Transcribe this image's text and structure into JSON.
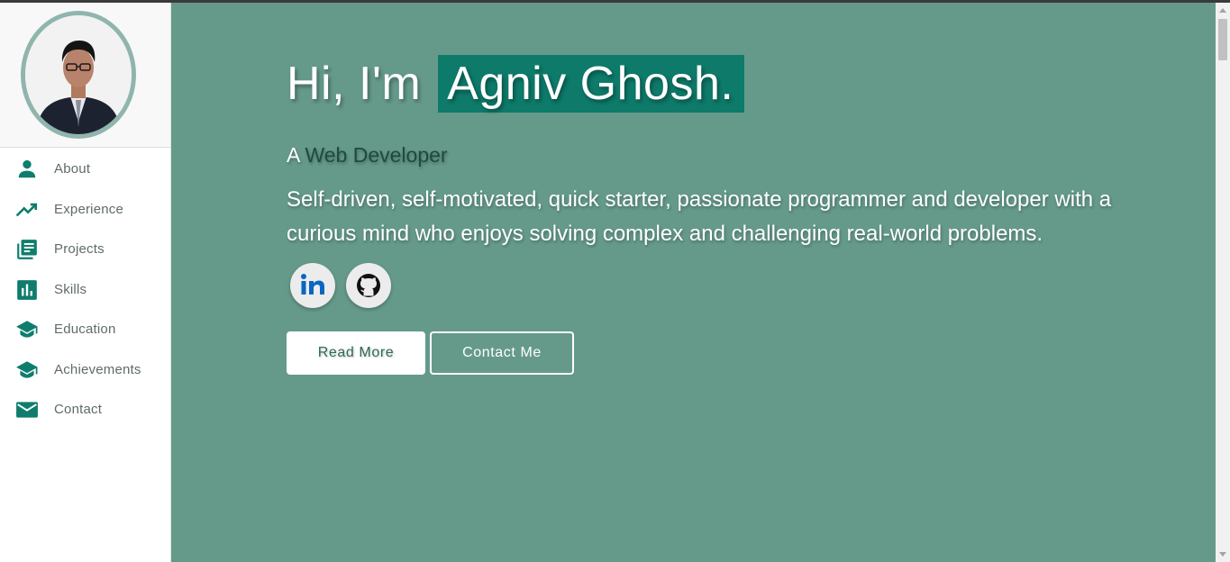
{
  "sidebar": {
    "items": [
      {
        "label": "About",
        "icon": "person-icon"
      },
      {
        "label": "Experience",
        "icon": "trending-up-icon"
      },
      {
        "label": "Projects",
        "icon": "library-books-icon"
      },
      {
        "label": "Skills",
        "icon": "bar-chart-icon"
      },
      {
        "label": "Education",
        "icon": "graduation-cap-icon"
      },
      {
        "label": "Achievements",
        "icon": "graduation-cap-icon"
      },
      {
        "label": "Contact",
        "icon": "mail-icon"
      }
    ]
  },
  "hero": {
    "greeting_prefix": "Hi, I'm",
    "name": "Agniv Ghosh.",
    "role_prefix": "A",
    "role": "Web Developer",
    "bio": "Self-driven, self-motivated, quick starter, passionate programmer and developer with a curious mind who enjoys solving complex and challenging real-world problems.",
    "social": [
      {
        "icon": "linkedin-icon"
      },
      {
        "icon": "github-icon"
      }
    ],
    "buttons": {
      "read_more": "Read More",
      "contact_me": "Contact Me"
    }
  },
  "colors": {
    "accent": "#0e7a6a",
    "hero_background": "#659a8b",
    "icon": "#0f7d6d"
  }
}
